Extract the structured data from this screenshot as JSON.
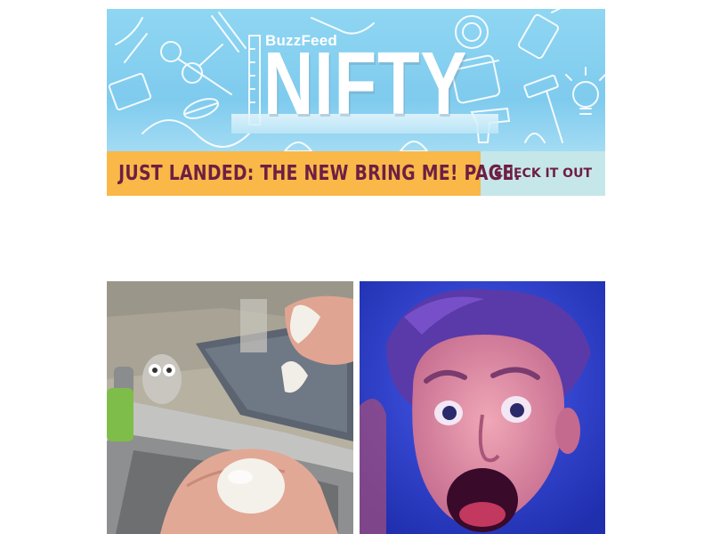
{
  "banner": {
    "brand": "BuzzFeed",
    "title": "NIFTY",
    "announcement": "JUST LANDED: THE NEW BRING ME! PAGE.",
    "cta_label": "CHECK IT OUT",
    "colors": {
      "hero_bg": "#8fd6f2",
      "strip_bg": "#f9b848",
      "cta_bg": "#c6e7e9",
      "text_dark": "#6e1f43"
    },
    "icons": [
      "scissors-icon",
      "ruler-icon",
      "pencil-icon",
      "hammer-icon",
      "lightbulb-icon",
      "jar-icon",
      "glue-gun-icon",
      "glue-bottle-icon",
      "needle-thread-icon",
      "flower-icon",
      "leaf-icon"
    ]
  },
  "images": {
    "left": {
      "subject": "hand-holding-peeled-egg-over-sink"
    },
    "right": {
      "subject": "shocked-boy-face-blue-light"
    }
  }
}
